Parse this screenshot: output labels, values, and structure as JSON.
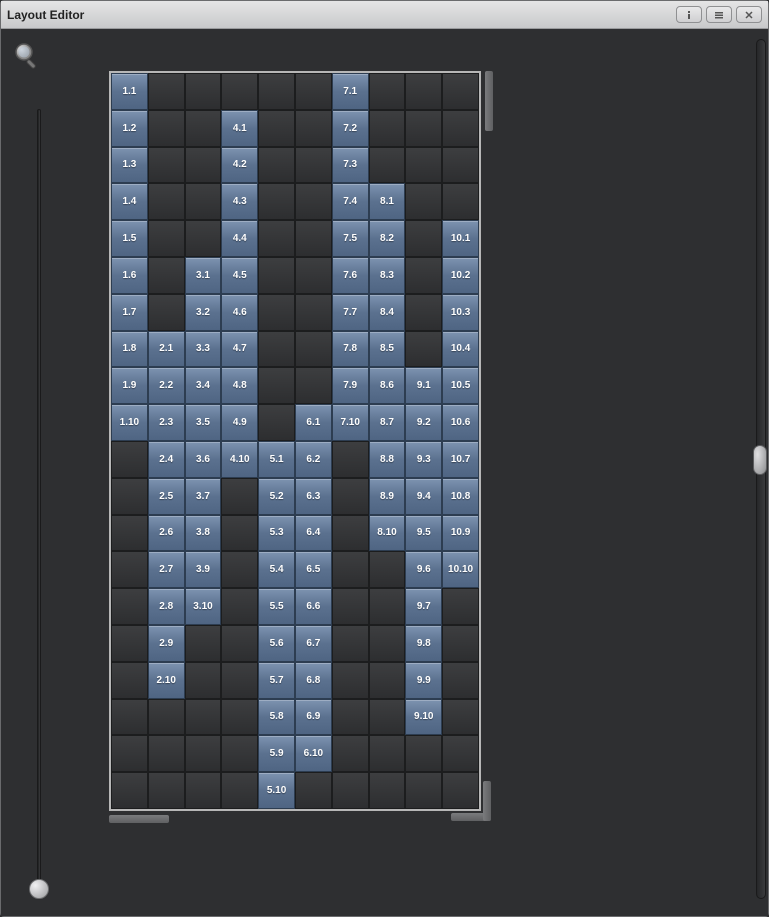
{
  "window": {
    "title": "Layout Editor"
  },
  "grid": {
    "cols": 10,
    "rows": 20,
    "cells": [
      {
        "col": 1,
        "row": 1,
        "label": "1.1"
      },
      {
        "col": 1,
        "row": 2,
        "label": "1.2"
      },
      {
        "col": 1,
        "row": 3,
        "label": "1.3"
      },
      {
        "col": 1,
        "row": 4,
        "label": "1.4"
      },
      {
        "col": 1,
        "row": 5,
        "label": "1.5"
      },
      {
        "col": 1,
        "row": 6,
        "label": "1.6"
      },
      {
        "col": 1,
        "row": 7,
        "label": "1.7"
      },
      {
        "col": 1,
        "row": 8,
        "label": "1.8"
      },
      {
        "col": 1,
        "row": 9,
        "label": "1.9"
      },
      {
        "col": 1,
        "row": 10,
        "label": "1.10"
      },
      {
        "col": 2,
        "row": 8,
        "label": "2.1"
      },
      {
        "col": 2,
        "row": 9,
        "label": "2.2"
      },
      {
        "col": 2,
        "row": 10,
        "label": "2.3"
      },
      {
        "col": 2,
        "row": 11,
        "label": "2.4"
      },
      {
        "col": 2,
        "row": 12,
        "label": "2.5"
      },
      {
        "col": 2,
        "row": 13,
        "label": "2.6"
      },
      {
        "col": 2,
        "row": 14,
        "label": "2.7"
      },
      {
        "col": 2,
        "row": 15,
        "label": "2.8"
      },
      {
        "col": 2,
        "row": 16,
        "label": "2.9"
      },
      {
        "col": 2,
        "row": 17,
        "label": "2.10"
      },
      {
        "col": 3,
        "row": 6,
        "label": "3.1"
      },
      {
        "col": 3,
        "row": 7,
        "label": "3.2"
      },
      {
        "col": 3,
        "row": 8,
        "label": "3.3"
      },
      {
        "col": 3,
        "row": 9,
        "label": "3.4"
      },
      {
        "col": 3,
        "row": 10,
        "label": "3.5"
      },
      {
        "col": 3,
        "row": 11,
        "label": "3.6"
      },
      {
        "col": 3,
        "row": 12,
        "label": "3.7"
      },
      {
        "col": 3,
        "row": 13,
        "label": "3.8"
      },
      {
        "col": 3,
        "row": 14,
        "label": "3.9"
      },
      {
        "col": 3,
        "row": 15,
        "label": "3.10"
      },
      {
        "col": 4,
        "row": 2,
        "label": "4.1"
      },
      {
        "col": 4,
        "row": 3,
        "label": "4.2"
      },
      {
        "col": 4,
        "row": 4,
        "label": "4.3"
      },
      {
        "col": 4,
        "row": 5,
        "label": "4.4"
      },
      {
        "col": 4,
        "row": 6,
        "label": "4.5"
      },
      {
        "col": 4,
        "row": 7,
        "label": "4.6"
      },
      {
        "col": 4,
        "row": 8,
        "label": "4.7"
      },
      {
        "col": 4,
        "row": 9,
        "label": "4.8"
      },
      {
        "col": 4,
        "row": 10,
        "label": "4.9"
      },
      {
        "col": 4,
        "row": 11,
        "label": "4.10"
      },
      {
        "col": 5,
        "row": 11,
        "label": "5.1"
      },
      {
        "col": 5,
        "row": 12,
        "label": "5.2"
      },
      {
        "col": 5,
        "row": 13,
        "label": "5.3"
      },
      {
        "col": 5,
        "row": 14,
        "label": "5.4"
      },
      {
        "col": 5,
        "row": 15,
        "label": "5.5"
      },
      {
        "col": 5,
        "row": 16,
        "label": "5.6"
      },
      {
        "col": 5,
        "row": 17,
        "label": "5.7"
      },
      {
        "col": 5,
        "row": 18,
        "label": "5.8"
      },
      {
        "col": 5,
        "row": 19,
        "label": "5.9"
      },
      {
        "col": 5,
        "row": 20,
        "label": "5.10"
      },
      {
        "col": 6,
        "row": 10,
        "label": "6.1"
      },
      {
        "col": 6,
        "row": 11,
        "label": "6.2"
      },
      {
        "col": 6,
        "row": 12,
        "label": "6.3"
      },
      {
        "col": 6,
        "row": 13,
        "label": "6.4"
      },
      {
        "col": 6,
        "row": 14,
        "label": "6.5"
      },
      {
        "col": 6,
        "row": 15,
        "label": "6.6"
      },
      {
        "col": 6,
        "row": 16,
        "label": "6.7"
      },
      {
        "col": 6,
        "row": 17,
        "label": "6.8"
      },
      {
        "col": 6,
        "row": 18,
        "label": "6.9"
      },
      {
        "col": 6,
        "row": 19,
        "label": "6.10"
      },
      {
        "col": 7,
        "row": 1,
        "label": "7.1"
      },
      {
        "col": 7,
        "row": 2,
        "label": "7.2"
      },
      {
        "col": 7,
        "row": 3,
        "label": "7.3"
      },
      {
        "col": 7,
        "row": 4,
        "label": "7.4"
      },
      {
        "col": 7,
        "row": 5,
        "label": "7.5"
      },
      {
        "col": 7,
        "row": 6,
        "label": "7.6"
      },
      {
        "col": 7,
        "row": 7,
        "label": "7.7"
      },
      {
        "col": 7,
        "row": 8,
        "label": "7.8"
      },
      {
        "col": 7,
        "row": 9,
        "label": "7.9"
      },
      {
        "col": 7,
        "row": 10,
        "label": "7.10"
      },
      {
        "col": 8,
        "row": 4,
        "label": "8.1"
      },
      {
        "col": 8,
        "row": 5,
        "label": "8.2"
      },
      {
        "col": 8,
        "row": 6,
        "label": "8.3"
      },
      {
        "col": 8,
        "row": 7,
        "label": "8.4"
      },
      {
        "col": 8,
        "row": 8,
        "label": "8.5"
      },
      {
        "col": 8,
        "row": 9,
        "label": "8.6"
      },
      {
        "col": 8,
        "row": 10,
        "label": "8.7"
      },
      {
        "col": 8,
        "row": 11,
        "label": "8.8"
      },
      {
        "col": 8,
        "row": 12,
        "label": "8.9"
      },
      {
        "col": 8,
        "row": 13,
        "label": "8.10"
      },
      {
        "col": 9,
        "row": 9,
        "label": "9.1"
      },
      {
        "col": 9,
        "row": 10,
        "label": "9.2"
      },
      {
        "col": 9,
        "row": 11,
        "label": "9.3"
      },
      {
        "col": 9,
        "row": 12,
        "label": "9.4"
      },
      {
        "col": 9,
        "row": 13,
        "label": "9.5"
      },
      {
        "col": 9,
        "row": 14,
        "label": "9.6"
      },
      {
        "col": 9,
        "row": 15,
        "label": "9.7"
      },
      {
        "col": 9,
        "row": 16,
        "label": "9.8"
      },
      {
        "col": 9,
        "row": 17,
        "label": "9.9"
      },
      {
        "col": 9,
        "row": 18,
        "label": "9.10"
      },
      {
        "col": 10,
        "row": 5,
        "label": "10.1"
      },
      {
        "col": 10,
        "row": 6,
        "label": "10.2"
      },
      {
        "col": 10,
        "row": 7,
        "label": "10.3"
      },
      {
        "col": 10,
        "row": 8,
        "label": "10.4"
      },
      {
        "col": 10,
        "row": 9,
        "label": "10.5"
      },
      {
        "col": 10,
        "row": 10,
        "label": "10.6"
      },
      {
        "col": 10,
        "row": 11,
        "label": "10.7"
      },
      {
        "col": 10,
        "row": 12,
        "label": "10.8"
      },
      {
        "col": 10,
        "row": 13,
        "label": "10.9"
      },
      {
        "col": 10,
        "row": 14,
        "label": "10.10"
      }
    ]
  }
}
